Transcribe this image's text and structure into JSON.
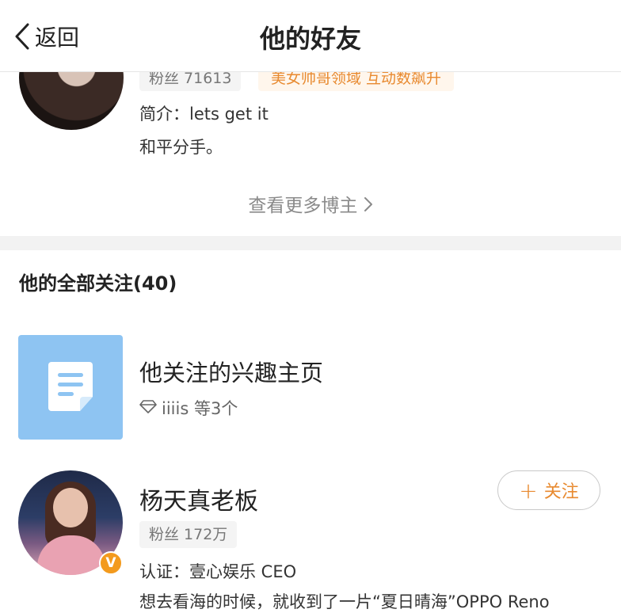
{
  "nav": {
    "back_label": "返回",
    "title": "他的好友"
  },
  "blogger_card": {
    "fans": "粉丝 71613",
    "tag": "美女帅哥领域 互动数飙升",
    "intro": "简介：lets get it",
    "post": "和平分手。",
    "more_link": "查看更多博主"
  },
  "following": {
    "header": "他的全部关注(40)",
    "interest_row": {
      "title": "他关注的兴趣主页",
      "subtitle": "iiiis 等3个"
    },
    "users": [
      {
        "name": "杨天真老板",
        "fans": "粉丝 172万",
        "verification": "认证：壹心娱乐 CEO",
        "post": "想去看海的时候，就收到了一片“夏日晴海”OPPO Reno",
        "follow_label": "关注",
        "verified_badge": "V"
      }
    ]
  },
  "colors": {
    "accent": "#e88a30",
    "tile_blue": "#8ec4f2",
    "verified": "#f39a1d"
  },
  "icons": [
    "chevron-left-icon",
    "chevron-right-icon",
    "document-icon",
    "diamond-icon",
    "plus-icon",
    "verified-icon"
  ]
}
